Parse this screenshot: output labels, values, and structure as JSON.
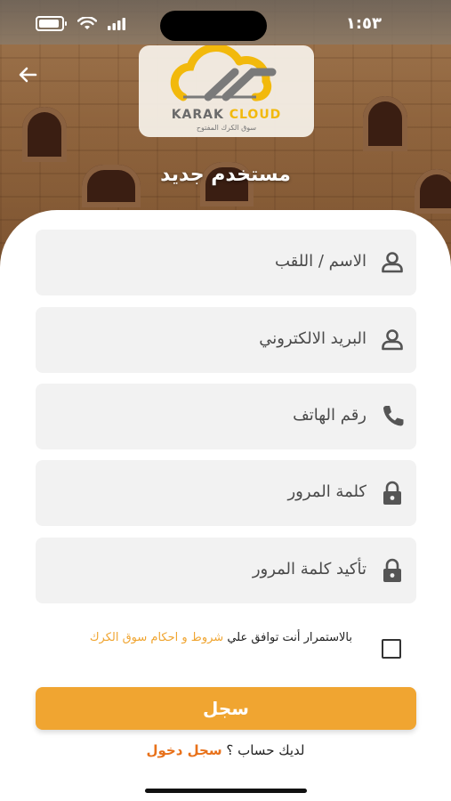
{
  "status_bar": {
    "time": "١:٥٣"
  },
  "header": {
    "logo_brand_first": "KARAK",
    "logo_brand_second": "CLOUD",
    "logo_tagline": "سوق الكرك المفتوح",
    "title": "مستخدم جديد"
  },
  "form": {
    "fields": [
      {
        "placeholder": "الاسم / اللقب",
        "icon": "person-icon"
      },
      {
        "placeholder": "البريد الالكتروني",
        "icon": "person-icon"
      },
      {
        "placeholder": "رقم الهاتف",
        "icon": "phone-icon"
      },
      {
        "placeholder": "كلمة المرور",
        "icon": "lock-icon"
      },
      {
        "placeholder": "تأكيد كلمة المرور",
        "icon": "lock-icon"
      }
    ],
    "terms_prefix": "بالاستمرار أنت توافق علي",
    "terms_link": "شروط و احكام سوق الكرك",
    "terms_checked": false,
    "register_label": "سجل",
    "have_account_text": "لديك حساب ؟",
    "login_link": "سجل دخول"
  },
  "colors": {
    "accent": "#f0a531",
    "link": "#e8711a",
    "field_bg": "#f2f2f2",
    "logo_yellow": "#f2b90c"
  }
}
